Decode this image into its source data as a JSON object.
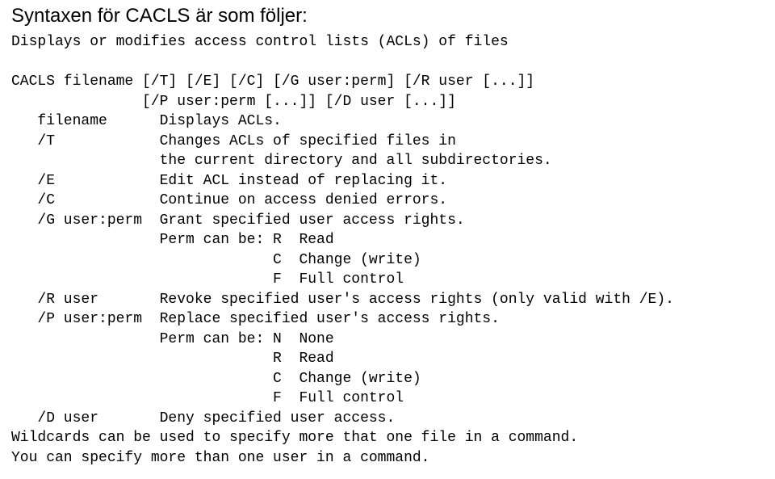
{
  "heading": "Syntaxen för CACLS är som följer:",
  "body": "Displays or modifies access control lists (ACLs) of files\n\nCACLS filename [/T] [/E] [/C] [/G user:perm] [/R user [...]]\n               [/P user:perm [...]] [/D user [...]]\n   filename      Displays ACLs.\n   /T            Changes ACLs of specified files in\n                 the current directory and all subdirectories.\n   /E            Edit ACL instead of replacing it.\n   /C            Continue on access denied errors.\n   /G user:perm  Grant specified user access rights.\n                 Perm can be: R  Read\n                              C  Change (write)\n                              F  Full control\n   /R user       Revoke specified user's access rights (only valid with /E).\n   /P user:perm  Replace specified user's access rights.\n                 Perm can be: N  None\n                              R  Read\n                              C  Change (write)\n                              F  Full control\n   /D user       Deny specified user access.\nWildcards can be used to specify more that one file in a command.\nYou can specify more than one user in a command."
}
